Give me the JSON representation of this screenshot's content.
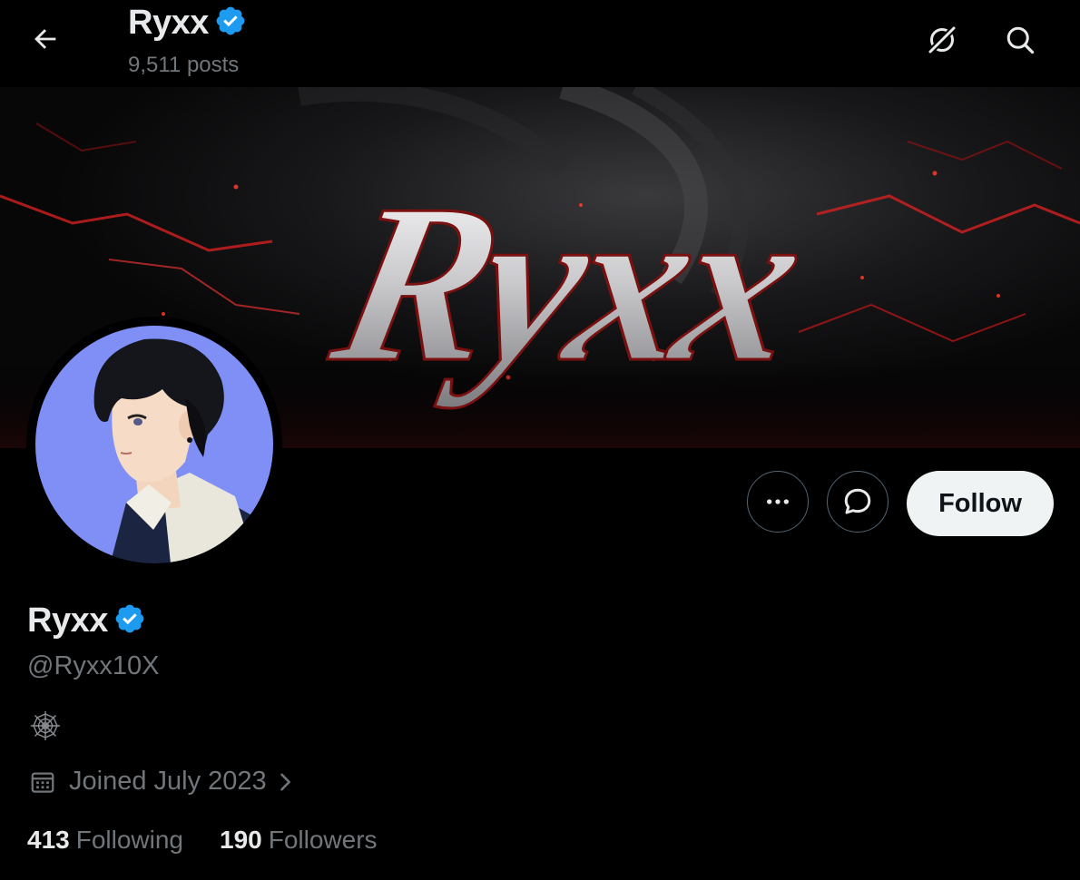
{
  "header": {
    "name": "Ryxx",
    "posts_count": "9,511 posts",
    "back_icon": "arrow-left-icon",
    "grok_icon": "grok-icon",
    "search_icon": "search-icon"
  },
  "banner": {
    "text": "Ryxx"
  },
  "actions": {
    "more_icon": "more-horizontal-icon",
    "message_icon": "message-bubble-icon",
    "follow_label": "Follow"
  },
  "profile": {
    "name": "Ryxx",
    "verified": true,
    "handle": "@Ryxx10X",
    "bio_icon": "spider-web-icon",
    "joined": "Joined July 2023",
    "following_count": "413",
    "following_label": "Following",
    "followers_count": "190",
    "followers_label": "Followers"
  },
  "colors": {
    "background": "#000000",
    "text_primary": "#e7e9ea",
    "text_secondary": "#71767b",
    "verified_blue": "#1d9bf0",
    "follow_button_bg": "#eff3f4",
    "banner_accent_red": "#d42020"
  }
}
